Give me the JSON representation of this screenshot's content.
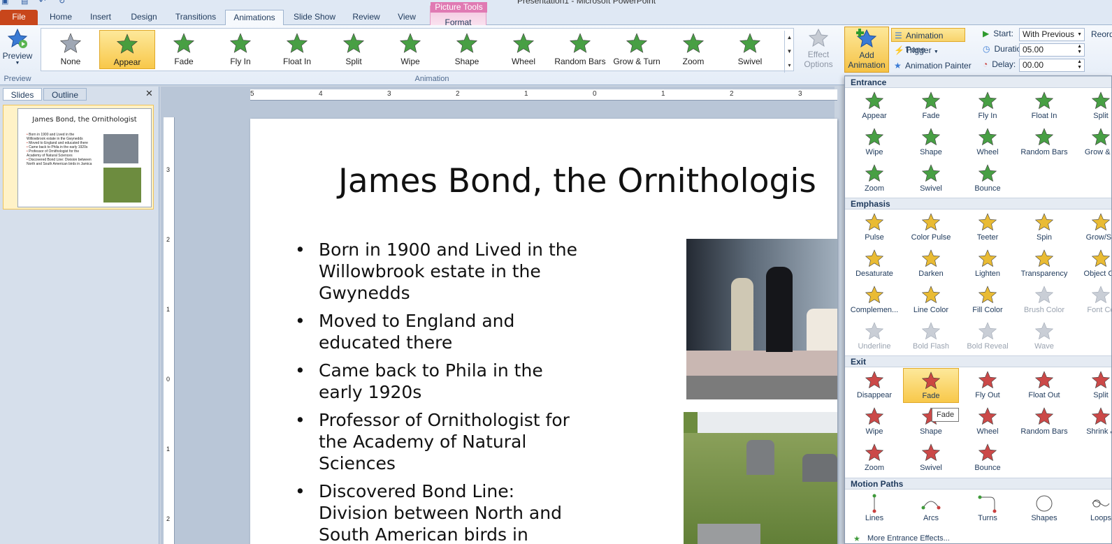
{
  "window": {
    "title": "Presentation1 - Microsoft PowerPoint"
  },
  "tabs": {
    "file": "File",
    "home": "Home",
    "insert": "Insert",
    "design": "Design",
    "transitions": "Transitions",
    "animations": "Animations",
    "slide_show": "Slide Show",
    "review": "Review",
    "view": "View",
    "picture_tools": "Picture Tools",
    "format": "Format"
  },
  "ribbon": {
    "preview": {
      "label": "Preview",
      "group": "Preview"
    },
    "animation_group": "Animation",
    "gallery": [
      "None",
      "Appear",
      "Fade",
      "Fly In",
      "Float In",
      "Split",
      "Wipe",
      "Shape",
      "Wheel",
      "Random Bars",
      "Grow & Turn",
      "Zoom",
      "Swivel"
    ],
    "gallery_selected": "Appear",
    "effect_options": {
      "line1": "Effect",
      "line2": "Options"
    },
    "add_animation": {
      "line1": "Add",
      "line2": "Animation"
    },
    "animation_pane": "Animation Pane",
    "trigger": "Trigger",
    "animation_painter": "Animation Painter",
    "start_label": "Start:",
    "start_value": "With Previous",
    "duration_label": "Duration:",
    "duration_value": "05.00",
    "delay_label": "Delay:",
    "delay_value": "00.00",
    "reorder": "Reord"
  },
  "slides_pane": {
    "tab_slides": "Slides",
    "tab_outline": "Outline",
    "slide_number": "1",
    "thumb_title": "James Bond, the Ornithologist",
    "thumb_bullets": [
      "Born in 1900 and Lived in the Willowbrook estate in the Gwynedds",
      "Moved to England and educated there",
      "Came back to Phila in the early 1920s",
      "Professor of Ornithologist for the Academy of Natural Sciences",
      "Discovered Bond Line: Division between North and South American birds in Jamica"
    ]
  },
  "ruler": {
    "h_ticks": [
      "5",
      "4",
      "3",
      "2",
      "1",
      "0",
      "1",
      "2",
      "3"
    ],
    "v_ticks": [
      "3",
      "2",
      "1",
      "0",
      "1",
      "2"
    ]
  },
  "slide": {
    "title": "James Bond, the Ornithologis",
    "bullets": [
      "Born in 1900 and Lived in the Willowbrook estate in the Gwynedds",
      "Moved to England and educated there",
      "Came back to Phila in the early 1920s",
      "Professor of Ornithologist for the Academy of Natural Sciences",
      "Discovered Bond Line: Division between North and South American birds in"
    ]
  },
  "dropdown": {
    "entrance_header": "Entrance",
    "entrance": [
      "Appear",
      "Fade",
      "Fly In",
      "Float In",
      "Split",
      "Wipe",
      "Shape",
      "Wheel",
      "Random Bars",
      "Grow & T",
      "Zoom",
      "Swivel",
      "Bounce"
    ],
    "emphasis_header": "Emphasis",
    "emphasis": [
      "Pulse",
      "Color Pulse",
      "Teeter",
      "Spin",
      "Grow/Sh",
      "Desaturate",
      "Darken",
      "Lighten",
      "Transparency",
      "Object Co",
      "Complemen...",
      "Line Color",
      "Fill Color",
      "Brush Color",
      "Font Co",
      "Underline",
      "Bold Flash",
      "Bold Reveal",
      "Wave"
    ],
    "exit_header": "Exit",
    "exit": [
      "Disappear",
      "Fade",
      "Fly Out",
      "Float Out",
      "Split",
      "Wipe",
      "Shape",
      "Wheel",
      "Random Bars",
      "Shrink &",
      "Zoom",
      "Swivel",
      "Bounce"
    ],
    "motion_header": "Motion Paths",
    "motion": [
      "Lines",
      "Arcs",
      "Turns",
      "Shapes",
      "Loops"
    ],
    "more": "More Entrance Effects...",
    "tooltip": "Fade"
  },
  "colors": {
    "entrance": "#3f9a3a",
    "emphasis": "#e8b82a",
    "exit": "#c9403f",
    "highlight": "#f8c84a",
    "file_tab": "#c8461b"
  }
}
